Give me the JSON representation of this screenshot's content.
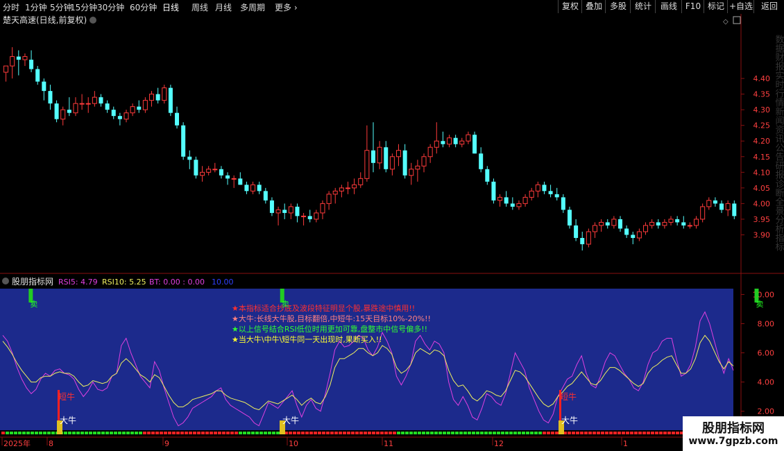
{
  "toolbar": {
    "periods": [
      "分时",
      "1分钟",
      "5分钟",
      "15分钟",
      "30分钟",
      "60分钟",
      "日线",
      "周线",
      "月线",
      "多周期",
      "更多"
    ],
    "active_index": 6,
    "right_buttons": [
      "复权",
      "叠加",
      "多股",
      "统计",
      "画线",
      "F10",
      "标记",
      "+自选",
      "返回"
    ]
  },
  "main_panel": {
    "title": "楚天高速(日线,前复权)",
    "right_side_text": "数据财报实时行情新闻资讯公告研报诊断全景分析指标"
  },
  "indicator_panel": {
    "name": "股朋指标网",
    "rsi5_label": "RSI5: 4.79",
    "rsi10_label": "RSI10: 5.25",
    "bt_label": "BT: 0.00 : 0.00",
    "extra_label": "10.00",
    "notes": [
      "★本指标适合抄底及波段特征明显个股,暴跌途中慎用!!",
      "★大牛:长线大牛股,目标翻倍,中短牛:15天目标10%-20%!!",
      "★以上信号结合RSI低位时用更加可靠,盘整市中信号偏多!!",
      "★当大牛\\中牛\\短牛同一天出现时,果断买入!!"
    ],
    "sell_label": "卖",
    "big_bull_label": "大牛",
    "short_bull_label": "短牛",
    "colors": {
      "bg": "#1c2a8c",
      "rsi5": "#e040e0",
      "rsi10": "#f0f060",
      "note1": "#ff3030",
      "note2": "#ff8080",
      "note3": "#30ff30",
      "note4": "#ffff30"
    }
  },
  "xaxis": {
    "labels": [
      "2025年",
      "8",
      "9",
      "10",
      "11",
      "12",
      "1"
    ]
  },
  "watermark": {
    "line1": "股朋指标网",
    "line2": "www.7gpzb.com"
  },
  "chart_data": [
    {
      "type": "candlestick",
      "title": "楚天高速(日线,前复权)",
      "ylim": [
        3.83,
        4.54
      ],
      "yticks": [
        4.4,
        4.35,
        4.3,
        4.25,
        4.2,
        4.15,
        4.1,
        4.05,
        4.0,
        3.95,
        3.9
      ],
      "ohlc": [
        [
          4.42,
          4.44,
          4.39,
          4.44
        ],
        [
          4.44,
          4.5,
          4.4,
          4.47
        ],
        [
          4.47,
          4.49,
          4.41,
          4.46
        ],
        [
          4.46,
          4.48,
          4.44,
          4.47
        ],
        [
          4.46,
          4.49,
          4.42,
          4.43
        ],
        [
          4.43,
          4.44,
          4.38,
          4.39
        ],
        [
          4.39,
          4.4,
          4.33,
          4.36
        ],
        [
          4.36,
          4.38,
          4.3,
          4.32
        ],
        [
          4.32,
          4.33,
          4.26,
          4.27
        ],
        [
          4.27,
          4.31,
          4.25,
          4.3
        ],
        [
          4.3,
          4.34,
          4.28,
          4.29
        ],
        [
          4.29,
          4.34,
          4.28,
          4.32
        ],
        [
          4.32,
          4.35,
          4.3,
          4.32
        ],
        [
          4.32,
          4.34,
          4.29,
          4.32
        ],
        [
          4.32,
          4.36,
          4.31,
          4.34
        ],
        [
          4.34,
          4.35,
          4.31,
          4.32
        ],
        [
          4.32,
          4.33,
          4.29,
          4.3
        ],
        [
          4.3,
          4.31,
          4.27,
          4.28
        ],
        [
          4.28,
          4.29,
          4.25,
          4.27
        ],
        [
          4.27,
          4.3,
          4.26,
          4.29
        ],
        [
          4.29,
          4.32,
          4.28,
          4.31
        ],
        [
          4.31,
          4.33,
          4.29,
          4.3
        ],
        [
          4.3,
          4.34,
          4.29,
          4.33
        ],
        [
          4.33,
          4.36,
          4.31,
          4.35
        ],
        [
          4.35,
          4.37,
          4.32,
          4.33
        ],
        [
          4.33,
          4.38,
          4.32,
          4.37
        ],
        [
          4.37,
          4.38,
          4.28,
          4.29
        ],
        [
          4.29,
          4.31,
          4.24,
          4.25
        ],
        [
          4.25,
          4.26,
          4.14,
          4.15
        ],
        [
          4.15,
          4.17,
          4.11,
          4.14
        ],
        [
          4.14,
          4.15,
          4.08,
          4.09
        ],
        [
          4.09,
          4.12,
          4.07,
          4.1
        ],
        [
          4.1,
          4.12,
          4.09,
          4.11
        ],
        [
          4.11,
          4.13,
          4.1,
          4.11
        ],
        [
          4.11,
          4.12,
          4.08,
          4.09
        ],
        [
          4.09,
          4.1,
          4.06,
          4.08
        ],
        [
          4.08,
          4.09,
          4.05,
          4.08
        ],
        [
          4.08,
          4.1,
          4.06,
          4.06
        ],
        [
          4.06,
          4.07,
          4.03,
          4.04
        ],
        [
          4.04,
          4.07,
          4.03,
          4.06
        ],
        [
          4.06,
          4.07,
          4.03,
          4.04
        ],
        [
          4.04,
          4.05,
          4.0,
          4.01
        ],
        [
          4.01,
          4.02,
          3.96,
          3.97
        ],
        [
          3.97,
          3.99,
          3.93,
          3.98
        ],
        [
          3.98,
          4.0,
          3.95,
          3.97
        ],
        [
          3.97,
          4.0,
          3.95,
          3.99
        ],
        [
          3.99,
          4.0,
          3.94,
          3.96
        ],
        [
          3.96,
          3.97,
          3.93,
          3.96
        ],
        [
          3.96,
          3.98,
          3.94,
          3.95
        ],
        [
          3.95,
          3.98,
          3.94,
          3.97
        ],
        [
          3.97,
          4.01,
          3.95,
          4.0
        ],
        [
          4.0,
          4.04,
          3.98,
          4.03
        ],
        [
          4.03,
          4.05,
          4.0,
          4.04
        ],
        [
          4.04,
          4.06,
          4.02,
          4.05
        ],
        [
          4.05,
          4.07,
          4.03,
          4.05
        ],
        [
          4.05,
          4.08,
          4.03,
          4.06
        ],
        [
          4.06,
          4.1,
          4.05,
          4.08
        ],
        [
          4.08,
          4.25,
          4.07,
          4.17
        ],
        [
          4.17,
          4.26,
          4.1,
          4.13
        ],
        [
          4.13,
          4.2,
          4.11,
          4.18
        ],
        [
          4.18,
          4.2,
          4.1,
          4.11
        ],
        [
          4.11,
          4.16,
          4.09,
          4.15
        ],
        [
          4.15,
          4.19,
          4.12,
          4.17
        ],
        [
          4.17,
          4.19,
          4.08,
          4.09
        ],
        [
          4.09,
          4.13,
          4.06,
          4.11
        ],
        [
          4.11,
          4.14,
          4.07,
          4.12
        ],
        [
          4.12,
          4.16,
          4.1,
          4.15
        ],
        [
          4.15,
          4.19,
          4.13,
          4.18
        ],
        [
          4.18,
          4.26,
          4.16,
          4.2
        ],
        [
          4.2,
          4.23,
          4.18,
          4.19
        ],
        [
          4.19,
          4.22,
          4.18,
          4.21
        ],
        [
          4.21,
          4.22,
          4.18,
          4.19
        ],
        [
          4.19,
          4.21,
          4.18,
          4.2
        ],
        [
          4.2,
          4.23,
          4.19,
          4.22
        ],
        [
          4.22,
          4.23,
          4.16,
          4.16
        ],
        [
          4.16,
          4.18,
          4.1,
          4.11
        ],
        [
          4.11,
          4.12,
          4.06,
          4.07
        ],
        [
          4.07,
          4.08,
          4.0,
          4.01
        ],
        [
          4.01,
          4.03,
          3.99,
          4.02
        ],
        [
          4.02,
          4.04,
          3.99,
          4.0
        ],
        [
          4.0,
          4.02,
          3.98,
          3.99
        ],
        [
          3.99,
          4.01,
          3.98,
          4.0
        ],
        [
          4.0,
          4.03,
          3.99,
          4.02
        ],
        [
          4.02,
          4.05,
          4.01,
          4.04
        ],
        [
          4.04,
          4.07,
          4.02,
          4.06
        ],
        [
          4.06,
          4.07,
          4.03,
          4.04
        ],
        [
          4.04,
          4.06,
          4.02,
          4.03
        ],
        [
          4.03,
          4.05,
          4.01,
          4.02
        ],
        [
          4.02,
          4.03,
          3.97,
          3.98
        ],
        [
          3.98,
          3.99,
          3.92,
          3.93
        ],
        [
          3.93,
          3.95,
          3.88,
          3.89
        ],
        [
          3.89,
          3.91,
          3.85,
          3.87
        ],
        [
          3.87,
          3.92,
          3.86,
          3.91
        ],
        [
          3.91,
          3.94,
          3.89,
          3.93
        ],
        [
          3.93,
          3.95,
          3.91,
          3.94
        ],
        [
          3.94,
          3.95,
          3.92,
          3.93
        ],
        [
          3.93,
          3.96,
          3.92,
          3.95
        ],
        [
          3.95,
          3.96,
          3.91,
          3.92
        ],
        [
          3.92,
          3.93,
          3.89,
          3.9
        ],
        [
          3.9,
          3.91,
          3.87,
          3.89
        ],
        [
          3.89,
          3.92,
          3.88,
          3.91
        ],
        [
          3.91,
          3.94,
          3.9,
          3.93
        ],
        [
          3.93,
          3.95,
          3.92,
          3.94
        ],
        [
          3.94,
          3.95,
          3.92,
          3.93
        ],
        [
          3.93,
          3.95,
          3.92,
          3.94
        ],
        [
          3.94,
          3.96,
          3.93,
          3.95
        ],
        [
          3.95,
          3.96,
          3.93,
          3.94
        ],
        [
          3.94,
          3.96,
          3.92,
          3.93
        ],
        [
          3.93,
          3.94,
          3.92,
          3.93
        ],
        [
          3.93,
          3.96,
          3.92,
          3.95
        ],
        [
          3.95,
          4.0,
          3.94,
          3.99
        ],
        [
          3.99,
          4.02,
          3.98,
          4.01
        ],
        [
          4.01,
          4.02,
          3.99,
          4.0
        ],
        [
          4.0,
          4.01,
          3.97,
          3.98
        ],
        [
          3.98,
          4.01,
          3.96,
          4.0
        ],
        [
          4.0,
          4.01,
          3.95,
          3.96
        ]
      ]
    },
    {
      "type": "line",
      "title": "股朋指标网",
      "ylim": [
        0.7,
        10.4
      ],
      "yticks": [
        10.0,
        8.0,
        6.0,
        4.0,
        2.0
      ],
      "series": [
        {
          "name": "RSI5",
          "values": [
            7.2,
            6.8,
            6.0,
            5.0,
            4.2,
            3.6,
            3.2,
            3.5,
            4.2,
            4.6,
            4.4,
            4.8,
            4.9,
            4.6,
            4.5,
            4.2,
            3.5,
            3.0,
            3.4,
            4.0,
            3.5,
            3.4,
            3.6,
            4.4,
            4.6,
            6.5,
            7.0,
            6.0,
            5.2,
            4.4,
            4.0,
            3.6,
            5.4,
            4.8,
            3.6,
            2.6,
            1.6,
            1.0,
            1.2,
            1.6,
            2.2,
            2.4,
            2.6,
            2.8,
            3.0,
            3.4,
            3.6,
            2.8,
            2.4,
            2.2,
            2.0,
            1.8,
            1.6,
            1.2,
            1.0,
            1.8,
            2.6,
            2.4,
            2.2,
            2.6,
            3.0,
            3.4,
            2.4,
            1.6,
            2.4,
            2.8,
            2.2,
            2.0,
            3.2,
            4.6,
            6.2,
            6.8,
            6.4,
            6.5,
            6.8,
            7.2,
            7.0,
            6.2,
            5.8,
            6.4,
            7.4,
            6.8,
            6.0,
            4.4,
            3.8,
            4.4,
            5.2,
            6.8,
            7.2,
            6.6,
            6.2,
            6.8,
            6.6,
            6.0,
            4.0,
            2.8,
            2.4,
            3.0,
            2.4,
            1.6,
            1.4,
            2.2,
            3.2,
            3.0,
            2.6,
            2.4,
            3.2,
            4.6,
            6.0,
            5.4,
            4.8,
            3.6,
            2.8,
            2.0,
            1.4,
            1.2,
            1.8,
            3.0,
            3.6,
            4.2,
            4.4,
            5.2,
            5.8,
            4.6,
            3.8,
            3.6,
            4.4,
            5.4,
            6.0,
            5.8,
            5.2,
            4.6,
            4.2,
            3.6,
            3.4,
            4.0,
            5.2,
            6.0,
            6.2,
            6.8,
            7.0,
            7.0,
            5.6,
            4.4,
            4.6,
            5.2,
            6.4,
            8.2,
            8.8,
            8.0,
            6.8,
            5.6,
            4.6,
            5.6,
            4.8
          ]
        },
        {
          "name": "RSI10",
          "values": [
            6.8,
            6.4,
            5.9,
            5.3,
            4.8,
            4.4,
            4.0,
            4.0,
            4.3,
            4.4,
            4.4,
            4.6,
            4.7,
            4.6,
            4.6,
            4.4,
            4.0,
            3.7,
            3.8,
            4.1,
            4.0,
            3.9,
            4.0,
            4.4,
            4.6,
            5.3,
            5.6,
            5.3,
            4.9,
            4.5,
            4.3,
            4.0,
            4.5,
            4.3,
            3.7,
            3.1,
            2.6,
            2.3,
            2.3,
            2.5,
            2.8,
            2.9,
            3.0,
            3.1,
            3.2,
            3.4,
            3.4,
            3.1,
            2.9,
            2.8,
            2.7,
            2.6,
            2.4,
            2.2,
            2.1,
            2.4,
            2.7,
            2.6,
            2.5,
            2.7,
            2.9,
            3.1,
            2.8,
            2.4,
            2.7,
            2.9,
            2.6,
            2.5,
            3.0,
            3.8,
            5.0,
            5.6,
            5.6,
            5.8,
            6.0,
            6.3,
            6.3,
            6.0,
            5.8,
            6.0,
            6.5,
            6.3,
            5.9,
            5.0,
            4.6,
            4.8,
            5.2,
            6.0,
            6.3,
            6.1,
            5.9,
            6.2,
            6.1,
            5.8,
            4.8,
            4.1,
            3.7,
            3.8,
            3.4,
            2.9,
            2.7,
            3.0,
            3.4,
            3.3,
            3.1,
            3.0,
            3.4,
            4.1,
            4.8,
            4.7,
            4.4,
            3.9,
            3.4,
            2.9,
            2.5,
            2.3,
            2.5,
            3.0,
            3.3,
            3.7,
            3.9,
            4.3,
            4.7,
            4.3,
            3.9,
            3.8,
            4.1,
            4.6,
            5.0,
            5.0,
            4.8,
            4.5,
            4.2,
            3.9,
            3.7,
            3.9,
            4.6,
            5.0,
            5.2,
            5.5,
            5.7,
            5.8,
            5.2,
            4.6,
            4.6,
            4.9,
            5.6,
            6.7,
            7.2,
            6.8,
            6.1,
            5.4,
            4.9,
            5.4,
            5.1
          ]
        }
      ],
      "signals": {
        "sell": [
          4,
          57,
          157
        ],
        "big_bull": [
          44,
          108,
          208
        ],
        "short_bull": [
          44,
          208
        ]
      }
    }
  ]
}
